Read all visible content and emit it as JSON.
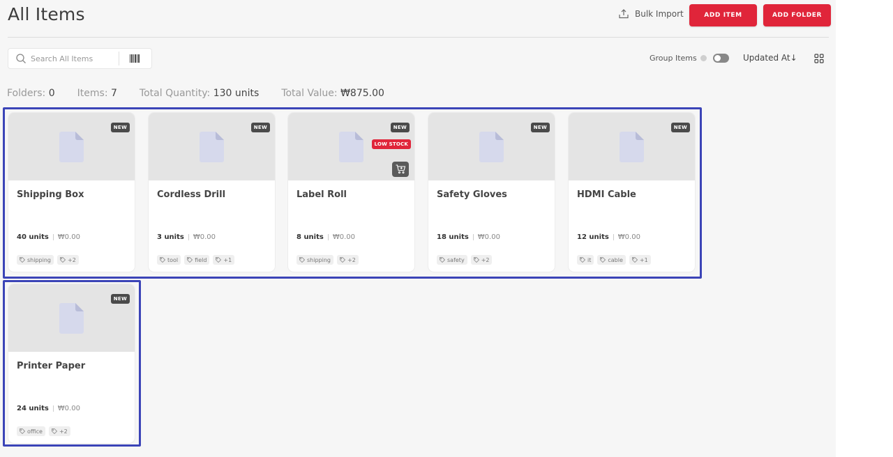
{
  "header": {
    "title": "All Items",
    "bulk_import": "Bulk Import",
    "add_item": "ADD ITEM",
    "add_folder": "ADD FOLDER"
  },
  "toolbar": {
    "search_placeholder": "Search All Items",
    "group_items": "Group Items",
    "sort": "Updated At↓"
  },
  "stats": {
    "folders_label": "Folders:",
    "folders_value": "0",
    "items_label": "Items:",
    "items_value": "7",
    "quantity_label": "Total Quantity:",
    "quantity_value": "130 units",
    "value_label": "Total Value:",
    "value_value": "₩875.00"
  },
  "badges": {
    "new": "NEW",
    "low_stock": "LOW STOCK"
  },
  "items": [
    {
      "name": "Shipping Box",
      "qty": "40 units",
      "price": "₩0.00",
      "tags": [
        "shipping",
        "+2"
      ]
    },
    {
      "name": "Cordless Drill",
      "qty": "3 units",
      "price": "₩0.00",
      "tags": [
        "tool",
        "field",
        "+1"
      ]
    },
    {
      "name": "Label Roll",
      "qty": "8 units",
      "price": "₩0.00",
      "tags": [
        "shipping",
        "+2"
      ]
    },
    {
      "name": "Safety Gloves",
      "qty": "18 units",
      "price": "₩0.00",
      "tags": [
        "safety",
        "+2"
      ]
    },
    {
      "name": "HDMI Cable",
      "qty": "12 units",
      "price": "₩0.00",
      "tags": [
        "it",
        "cable",
        "+1"
      ]
    },
    {
      "name": "Printer Paper",
      "qty": "24 units",
      "price": "₩0.00",
      "tags": [
        "office",
        "+2"
      ]
    }
  ],
  "colors": {
    "accent": "#e0253a",
    "selection": "#3b44b7",
    "badge_dark": "#4a4a4a"
  }
}
